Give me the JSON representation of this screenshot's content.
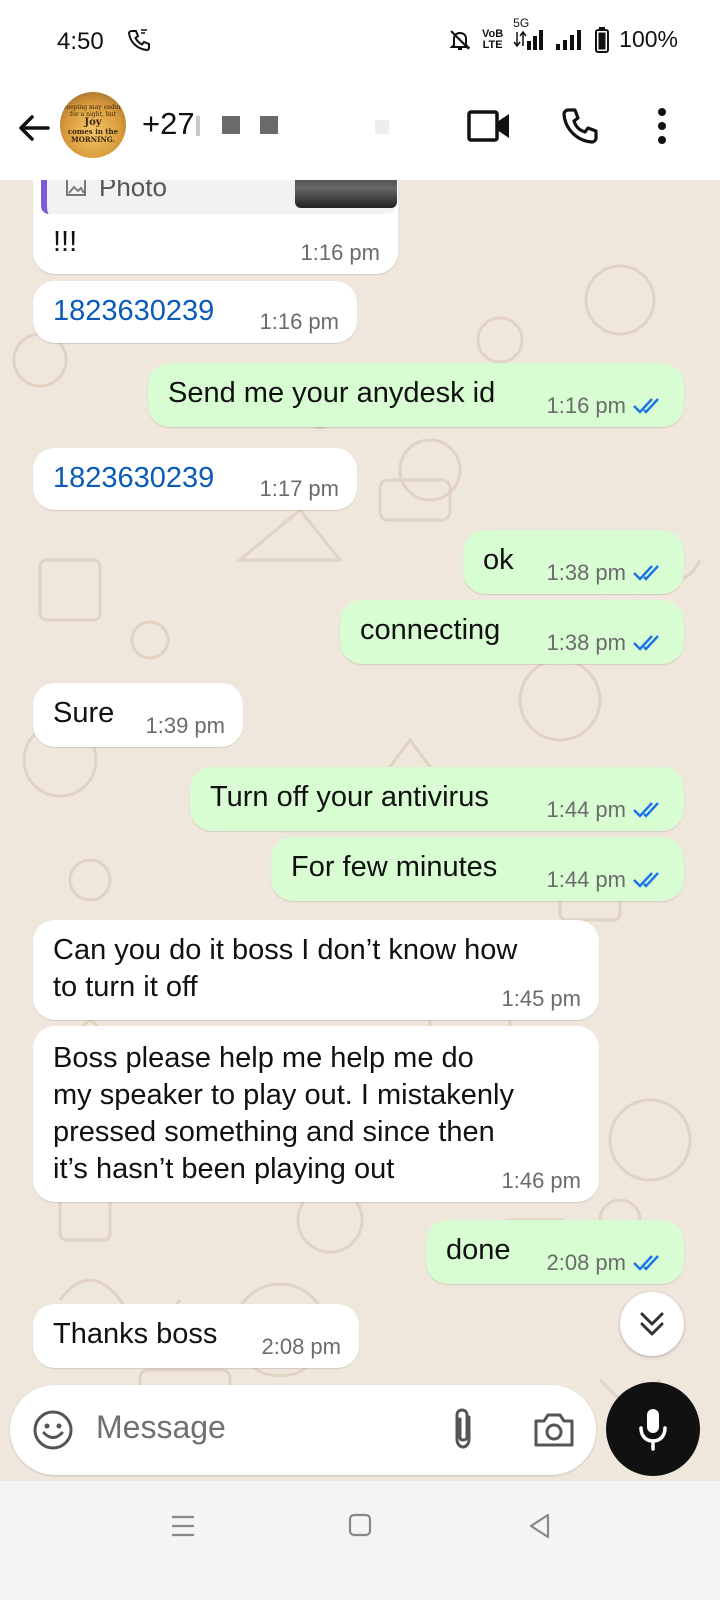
{
  "status_bar": {
    "time": "4:50",
    "network_label": "VoLTE",
    "network_5g": "5G",
    "battery": "100%"
  },
  "header": {
    "contact_name": "+27",
    "avatar_text": {
      "line1": "Weeping may endure for a night, but",
      "line2": "Joy",
      "line3": "comes in the MORNING."
    }
  },
  "messages": [
    {
      "side": "in",
      "quote_label": "Photo",
      "text": "!!!",
      "time": "1:16 pm"
    },
    {
      "side": "in",
      "text": "1823630239",
      "time": "1:16 pm",
      "link": true
    },
    {
      "side": "out",
      "text": "Send me your anydesk id",
      "time": "1:16 pm",
      "ticks": "read"
    },
    {
      "side": "in",
      "text": "1823630239",
      "time": "1:17 pm",
      "link": true
    },
    {
      "side": "out",
      "text": "ok",
      "time": "1:38 pm",
      "ticks": "read"
    },
    {
      "side": "out",
      "text": "connecting",
      "time": "1:38 pm",
      "ticks": "read"
    },
    {
      "side": "in",
      "text": "Sure",
      "time": "1:39 pm"
    },
    {
      "side": "out",
      "text": "Turn off your antivirus",
      "time": "1:44 pm",
      "ticks": "read"
    },
    {
      "side": "out",
      "text": "For few minutes",
      "time": "1:44 pm",
      "ticks": "read"
    },
    {
      "side": "in",
      "text": "Can you do it boss I don’t know how\nto turn it off",
      "time": "1:45 pm"
    },
    {
      "side": "in",
      "text": "Boss please help me help me do\nmy speaker to play out. I mistakenly\npressed something and since then\nit’s hasn’t been playing out",
      "time": "1:46 pm"
    },
    {
      "side": "out",
      "text": "done",
      "time": "2:08 pm",
      "ticks": "read"
    },
    {
      "side": "in",
      "text": "Thanks boss",
      "time": "2:08 pm"
    }
  ],
  "composer": {
    "placeholder": "Message"
  },
  "colors": {
    "chat_background": "#efe6dc",
    "incoming_bubble": "#ffffff",
    "outgoing_bubble": "#d9fdd3",
    "read_ticks": "#1a73e8",
    "link_text": "#0b5bb8",
    "quote_bar": "#7b5cd6"
  },
  "icons": [
    "back-arrow-icon",
    "video-call-icon",
    "phone-call-icon",
    "more-options-icon",
    "emoji-icon",
    "attach-icon",
    "camera-icon",
    "mic-icon",
    "scroll-down-icon"
  ]
}
